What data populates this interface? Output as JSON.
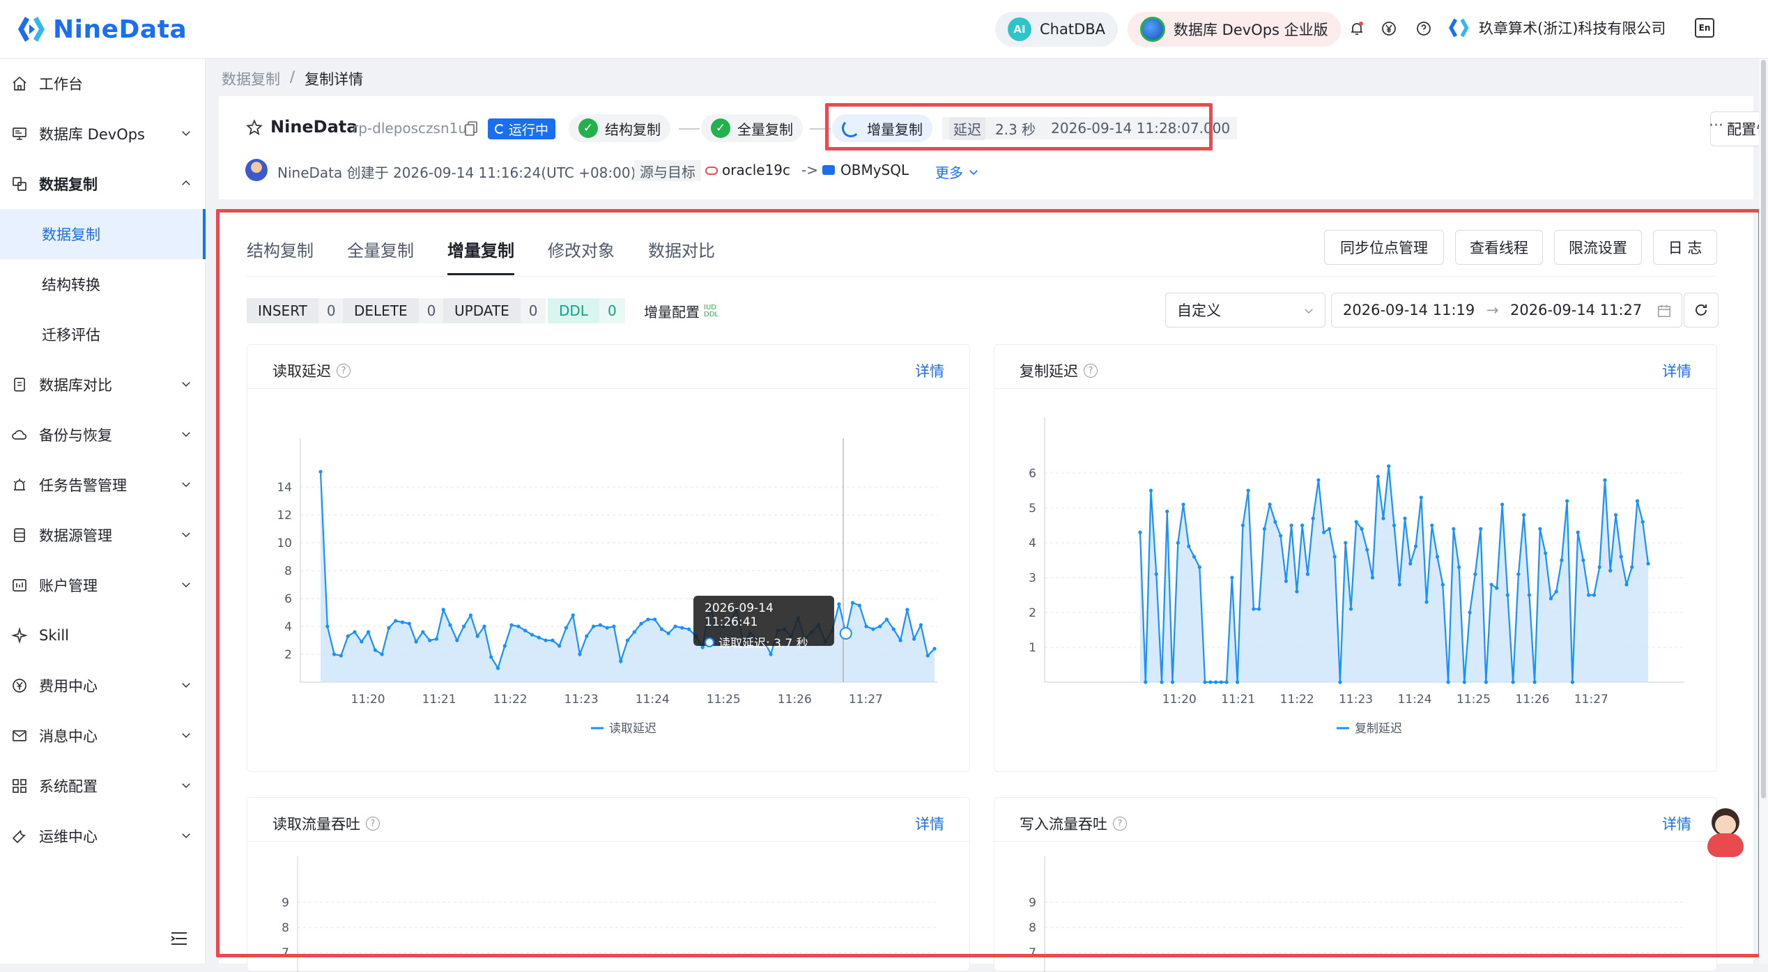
{
  "header": {
    "logo_text": "NineData",
    "chatdba_label": "ChatDBA",
    "chatdba_badge": "AI",
    "edition_label": "数据库 DevOps 企业版",
    "org_name": "玖章算术(浙江)科技有限公司",
    "lang_label": "En"
  },
  "sidebar": {
    "items": [
      {
        "label": "工作台",
        "icon": "home-icon"
      },
      {
        "label": "数据库 DevOps",
        "icon": "monitor-icon"
      },
      {
        "label": "数据复制",
        "icon": "copy-icon"
      },
      {
        "label": "数据复制"
      },
      {
        "label": "结构转换"
      },
      {
        "label": "迁移评估"
      },
      {
        "label": "数据库对比",
        "icon": "compare-icon"
      },
      {
        "label": "备份与恢复",
        "icon": "cloud-icon"
      },
      {
        "label": "任务告警管理",
        "icon": "alarm-icon"
      },
      {
        "label": "数据源管理",
        "icon": "database-icon"
      },
      {
        "label": "账户管理",
        "icon": "account-icon"
      },
      {
        "label": "Skill",
        "icon": "skill-icon"
      },
      {
        "label": "费用中心",
        "icon": "yen-icon"
      },
      {
        "label": "消息中心",
        "icon": "mail-icon"
      },
      {
        "label": "系统配置",
        "icon": "grid-icon"
      },
      {
        "label": "运维中心",
        "icon": "wrench-icon"
      }
    ]
  },
  "breadcrumb": {
    "parent": "数据复制",
    "separator": "/",
    "current": "复制详情"
  },
  "task": {
    "name": "NineData",
    "id": "rp-dleposczsn1u",
    "status": "运行中",
    "step1": "结构复制",
    "step2": "全量复制",
    "step3": "增量复制",
    "delay_label": "延迟",
    "delay_value": "2.3 秒",
    "delay_time": "2026-09-14 11:28:07.000",
    "alert_button": "配置告警",
    "more_dots": "···",
    "creator_line": "NineData 创建于 2026-09-14 11:16:24(UTC +08:00)",
    "source_target_label": "源与目标",
    "source": "oracle19c",
    "arrow": "->",
    "target": "OBMySQL",
    "more_label": "更多"
  },
  "tabs": [
    "结构复制",
    "全量复制",
    "增量复制",
    "修改对象",
    "数据对比"
  ],
  "actions": [
    "同步位点管理",
    "查看线程",
    "限流设置",
    "日 志"
  ],
  "stats": [
    {
      "key": "INSERT",
      "value": "0"
    },
    {
      "key": "DELETE",
      "value": "0"
    },
    {
      "key": "UPDATE",
      "value": "0"
    },
    {
      "key": "DDL",
      "value": "0"
    }
  ],
  "incremental_config_label": "增量配置",
  "incremental_config_badge": "IUD DDL",
  "range": {
    "mode": "自定义",
    "start": "2026-09-14 11:19",
    "arrow": "→",
    "end": "2026-09-14 11:27"
  },
  "detail_link": "详情",
  "tooltip": {
    "time": "2026-09-14 11:26:41",
    "text": "读取延迟: 3.7 秒"
  },
  "colors": {
    "accent": "#1a6ff0",
    "line": "#1890ff",
    "fill": "#cfe6fb",
    "highlight": "#e84a4e",
    "ok": "#23b14d"
  },
  "chart_data": [
    {
      "type": "area",
      "title": "读取延迟",
      "x_ticks": [
        "11:20",
        "11:21",
        "11:22",
        "11:23",
        "11:24",
        "11:25",
        "11:26",
        "11:27"
      ],
      "y_ticks": [
        2,
        4,
        6,
        8,
        10,
        12,
        14
      ],
      "ylim": [
        0,
        16
      ],
      "x_range": [
        "11:19:20",
        "11:27:58"
      ],
      "legend": "读取延迟",
      "series": [
        {
          "name": "读取延迟",
          "values": [
            15.1,
            4,
            2,
            1.9,
            3.3,
            3.6,
            2.9,
            3.6,
            2.3,
            2,
            3.9,
            4.4,
            4.3,
            4.2,
            2.9,
            3.6,
            3,
            3.1,
            5.2,
            4.1,
            3,
            4,
            4.8,
            3.3,
            4,
            1.8,
            1,
            2.6,
            4.1,
            4,
            3.7,
            3.4,
            3.2,
            3,
            3,
            2.6,
            3.9,
            4.8,
            2,
            3.3,
            4,
            4.1,
            3.9,
            4,
            1.5,
            3,
            3.6,
            4.2,
            4.5,
            4.5,
            3.8,
            3.5,
            4,
            3.9,
            3.8,
            3.3,
            2.5,
            5.4,
            4.1,
            4,
            4.3,
            5.2,
            2.7,
            3.5,
            3.1,
            3,
            2,
            3.7,
            3.8,
            3.3,
            4.6,
            3.1,
            3.6,
            4.1,
            2.9,
            3.7,
            5.6,
            3.5,
            5.7,
            5.5,
            4,
            3.8,
            4,
            4.5,
            3.8,
            3,
            5.2,
            3.1,
            4.1,
            1.9,
            2.4
          ]
        }
      ],
      "tooltip_x": "11:26:41"
    },
    {
      "type": "area",
      "title": "复制延迟",
      "x_ticks": [
        "11:20",
        "11:21",
        "11:22",
        "11:23",
        "11:24",
        "11:25",
        "11:26",
        "11:27"
      ],
      "y_ticks": [
        1,
        2,
        3,
        4,
        5,
        6
      ],
      "ylim": [
        0,
        7
      ],
      "x_range": [
        "11:19:20",
        "11:27:58"
      ],
      "legend": "复制延迟",
      "series": [
        {
          "name": "复制延迟",
          "values": [
            4.3,
            0,
            5.5,
            3.1,
            0,
            4.9,
            0,
            4,
            5.1,
            3.9,
            3.6,
            3.3,
            0,
            0,
            0,
            0,
            0,
            3,
            0,
            4.5,
            5.5,
            2.1,
            2.1,
            4.4,
            5.1,
            4.6,
            4.2,
            2.9,
            4.5,
            2.6,
            4.5,
            3.1,
            4.7,
            5.8,
            4.3,
            4.4,
            3.6,
            0,
            4,
            2.1,
            4.6,
            4.4,
            3.8,
            3,
            5.9,
            4.7,
            6.2,
            4.5,
            2.8,
            4.7,
            3.4,
            3.9,
            5.3,
            2.3,
            4.5,
            3.6,
            2.8,
            0,
            4.4,
            3.3,
            0,
            2,
            3.1,
            4.4,
            0,
            2.8,
            2.7,
            5.1,
            2.5,
            0,
            3.1,
            4.8,
            2.5,
            0,
            4.4,
            3.7,
            2.4,
            2.6,
            3.5,
            5.2,
            0,
            4.3,
            3.5,
            2.5,
            2.5,
            3.3,
            5.8,
            3.2,
            4.8,
            3.6,
            2.8,
            3.3,
            5.2,
            4.6,
            3.4
          ]
        }
      ]
    },
    {
      "type": "area",
      "title": "读取流量吞吐",
      "y_ticks": [
        7,
        8,
        9
      ],
      "ylim": [
        0,
        10
      ],
      "series": []
    },
    {
      "type": "area",
      "title": "写入流量吞吐",
      "y_ticks": [
        7,
        8,
        9
      ],
      "ylim": [
        0,
        10
      ],
      "series": []
    }
  ]
}
